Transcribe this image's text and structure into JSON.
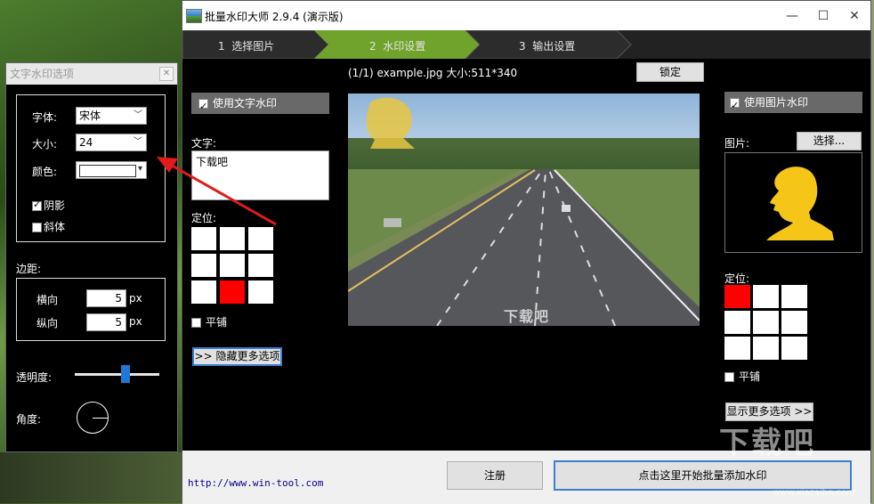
{
  "main_window": {
    "title": "批量水印大师 2.9.4 (演示版)",
    "controls": {
      "minimize": "—",
      "maximize": "☐",
      "close": "✕"
    }
  },
  "steps": [
    {
      "num": "1",
      "label": "选择图片"
    },
    {
      "num": "2",
      "label": "水印设置"
    },
    {
      "num": "3",
      "label": "输出设置"
    }
  ],
  "info_bar": {
    "file_info": "(1/1) example.jpg 大小:511*340",
    "lock_label": "锁定"
  },
  "text_watermark": {
    "enable_label": "使用文字水印",
    "text_label": "文字:",
    "text_value": "下载吧",
    "position_label": "定位:",
    "position_grid": [
      0,
      0,
      0,
      0,
      0,
      0,
      0,
      1,
      0
    ],
    "tile_label": "平铺",
    "more_btn": ">> 隐藏更多选项"
  },
  "preview": {
    "watermark_text": "下载吧"
  },
  "image_watermark": {
    "enable_label": "使用图片水印",
    "image_label": "图片:",
    "choose_btn": "选择...",
    "position_label": "定位:",
    "position_grid": [
      1,
      0,
      0,
      0,
      0,
      0,
      0,
      0,
      0
    ],
    "tile_label": "平铺",
    "more_btn": "显示更多选项 >>"
  },
  "footer": {
    "url": "http://www.win-tool.com",
    "register_btn": "注册",
    "start_btn": "点击这里开始批量添加水印"
  },
  "options_dialog": {
    "title": "文字水印选项",
    "close": "✕",
    "font_label": "字体:",
    "font_value": "宋体",
    "size_label": "大小:",
    "size_value": "24",
    "color_label": "颜色:",
    "color_value": "#ffffff",
    "shadow_label": "阴影",
    "italic_label": "斜体",
    "margin_label": "边距:",
    "horizontal_label": "横向",
    "horizontal_value": "5",
    "vertical_label": "纵向",
    "vertical_value": "5",
    "unit": "px",
    "opacity_label": "透明度:",
    "opacity_value": 0.6,
    "angle_label": "角度:"
  },
  "watermark_logo": {
    "text": "下载吧",
    "sub": "www.xiazaiba.com"
  },
  "colors": {
    "accent_green": "#6fa32c",
    "selected_cell": "#ff0000",
    "dialog_bg": "#000000"
  }
}
